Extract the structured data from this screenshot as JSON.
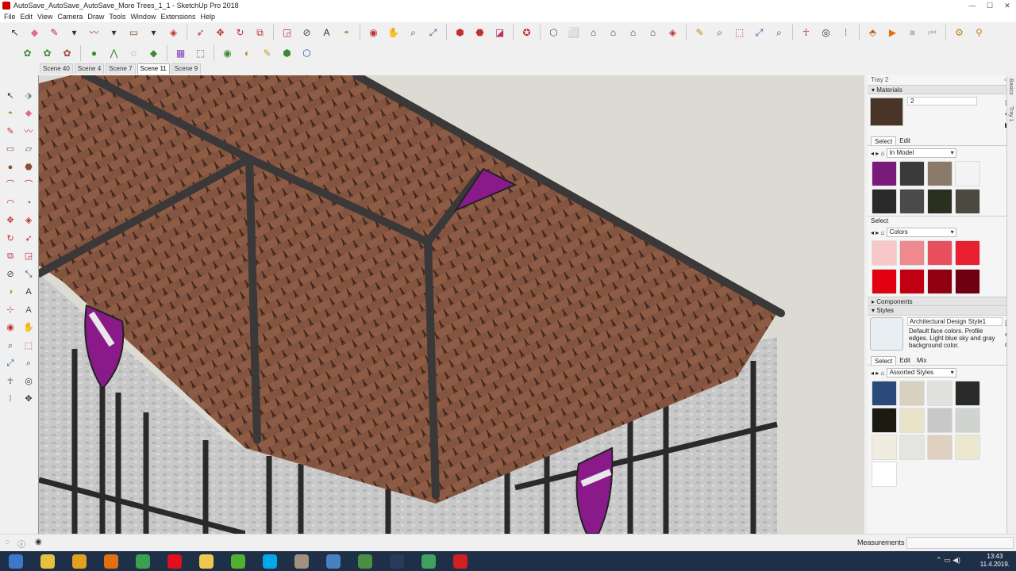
{
  "window": {
    "title": "AutoSave_AutoSave_AutoSave_More Trees_1_1 - SketchUp Pro 2018",
    "controls": {
      "minimize": "—",
      "maximize": "☐",
      "close": "✕"
    }
  },
  "menu": [
    "File",
    "Edit",
    "View",
    "Camera",
    "Draw",
    "Tools",
    "Window",
    "Extensions",
    "Help"
  ],
  "toolbar_main": [
    {
      "name": "select-icon",
      "glyph": "↖",
      "color": "#333"
    },
    {
      "name": "eraser-icon",
      "glyph": "◆",
      "color": "#e06a8a"
    },
    {
      "name": "line-pencil-icon",
      "glyph": "✎",
      "color": "#c03030"
    },
    {
      "name": "line-dropdown-icon",
      "glyph": "▾",
      "color": "#333"
    },
    {
      "name": "freehand-icon",
      "glyph": "〰",
      "color": "#c03030"
    },
    {
      "name": "freehand-dropdown-icon",
      "glyph": "▾",
      "color": "#333"
    },
    {
      "name": "rectangle-icon",
      "glyph": "▭",
      "color": "#8a5030"
    },
    {
      "name": "rectangle-dropdown-icon",
      "glyph": "▾",
      "color": "#333"
    },
    {
      "name": "push-pull-icon",
      "glyph": "◈",
      "color": "#c03030"
    },
    {
      "name": "follow-me-icon",
      "glyph": "➶",
      "color": "#c03030"
    },
    {
      "name": "move-icon",
      "glyph": "✥",
      "color": "#c03030"
    },
    {
      "name": "rotate-icon",
      "glyph": "↻",
      "color": "#c03030"
    },
    {
      "name": "scale-icon",
      "glyph": "⧉",
      "color": "#c03030"
    },
    {
      "name": "offset-icon",
      "glyph": "◲",
      "color": "#c03030"
    },
    {
      "name": "tape-measure-icon",
      "glyph": "⊘",
      "color": "#444"
    },
    {
      "name": "text-icon",
      "glyph": "A",
      "color": "#333"
    },
    {
      "name": "paint-bucket-icon",
      "glyph": "◓",
      "color": "#c08020"
    },
    {
      "name": "orbit-icon",
      "glyph": "◉",
      "color": "#c03030"
    },
    {
      "name": "pan-icon",
      "glyph": "✋",
      "color": "#c08020"
    },
    {
      "name": "zoom-icon",
      "glyph": "⌕",
      "color": "#2050a0"
    },
    {
      "name": "zoom-extents-icon",
      "glyph": "⤢",
      "color": "#2050a0"
    },
    {
      "name": "warehouse-icon",
      "glyph": "⬢",
      "color": "#c03030"
    },
    {
      "name": "extension-warehouse-icon",
      "glyph": "⬣",
      "color": "#c03030"
    },
    {
      "name": "send-to-layout-icon",
      "glyph": "◪",
      "color": "#c03060"
    },
    {
      "name": "extension-manager-icon",
      "glyph": "✪",
      "color": "#c03030"
    },
    {
      "name": "iso-view-icon",
      "glyph": "⬡",
      "color": "#555"
    },
    {
      "name": "top-view-icon",
      "glyph": "⬜",
      "color": "#555"
    },
    {
      "name": "front-view-icon",
      "glyph": "⌂",
      "color": "#333"
    },
    {
      "name": "right-view-icon",
      "glyph": "⌂",
      "color": "#333"
    },
    {
      "name": "back-view-icon",
      "glyph": "⌂",
      "color": "#333"
    },
    {
      "name": "left-view-icon",
      "glyph": "⌂",
      "color": "#333"
    },
    {
      "name": "walk-icon",
      "glyph": "◈",
      "color": "#c03030"
    },
    {
      "name": "position-camera-icon",
      "glyph": "✎",
      "color": "#c08020"
    },
    {
      "name": "zoom-window-icon",
      "glyph": "⌕",
      "color": "#2050a0"
    },
    {
      "name": "zoom-window2-icon",
      "glyph": "⬚",
      "color": "#c03030"
    },
    {
      "name": "zoom-extents2-icon",
      "glyph": "⤢",
      "color": "#2050a0"
    },
    {
      "name": "look-around-icon",
      "glyph": "⌕",
      "color": "#2050a0"
    },
    {
      "name": "walk-figure-icon",
      "glyph": "☥",
      "color": "#c03030"
    },
    {
      "name": "eye-icon",
      "glyph": "◎",
      "color": "#333"
    },
    {
      "name": "footprints-icon",
      "glyph": "⁞",
      "color": "#555"
    },
    {
      "name": "section-plane-icon",
      "glyph": "⬘",
      "color": "#c06020"
    },
    {
      "name": "play-icon",
      "glyph": "▶",
      "color": "#e07010"
    },
    {
      "name": "stop-icon",
      "glyph": "■",
      "color": "#bbb"
    },
    {
      "name": "previous-icon",
      "glyph": "⏮",
      "color": "#bbb"
    },
    {
      "name": "component-options-icon",
      "glyph": "⚙",
      "color": "#c08020"
    },
    {
      "name": "component-attributes-icon",
      "glyph": "⚲",
      "color": "#c08020"
    }
  ],
  "toolbar_second": [
    {
      "name": "sandbox-from-contours-icon",
      "glyph": "✿",
      "color": "#3a8a30"
    },
    {
      "name": "sandbox-from-scratch-icon",
      "glyph": "✿",
      "color": "#3a8a30"
    },
    {
      "name": "smoove-icon",
      "glyph": "✿",
      "color": "#a04040"
    },
    {
      "name": "stamp-icon",
      "glyph": "●",
      "color": "#3a8a30"
    },
    {
      "name": "drape-icon",
      "glyph": "⋀",
      "color": "#3a8a30"
    },
    {
      "name": "add-detail-icon",
      "glyph": "◌",
      "color": "#3a8a30"
    },
    {
      "name": "flip-edge-icon",
      "glyph": "◆",
      "color": "#3a8a30"
    },
    {
      "name": "color-by-icon",
      "glyph": "▦",
      "color": "#8040c0"
    },
    {
      "name": "vertex-tools-icon",
      "glyph": "⬚",
      "color": "#555"
    },
    {
      "name": "geo-location-icon",
      "glyph": "◉",
      "color": "#3a8a30"
    },
    {
      "name": "shadow-icon",
      "glyph": "◐",
      "color": "#c08020"
    },
    {
      "name": "photo-texture-icon",
      "glyph": "✎",
      "color": "#c0a020"
    },
    {
      "name": "model-info-icon",
      "glyph": "⬢",
      "color": "#3a8a30"
    },
    {
      "name": "match-photo-icon",
      "glyph": "⬡",
      "color": "#2050a0"
    }
  ],
  "scenes": [
    "Scene 40",
    "Scene 4",
    "Scene 7",
    "Scene 11",
    "Scene 9"
  ],
  "active_scene": "Scene 11",
  "left_tools": [
    {
      "name": "select-icon",
      "glyph": "↖",
      "color": "#333"
    },
    {
      "name": "make-component-icon",
      "glyph": "⬗",
      "color": "#888"
    },
    {
      "name": "paint-icon",
      "glyph": "◓",
      "color": "#c08020"
    },
    {
      "name": "eraser-icon",
      "glyph": "◆",
      "color": "#e06a8a"
    },
    {
      "name": "line-icon",
      "glyph": "✎",
      "color": "#c03030"
    },
    {
      "name": "freehand-icon",
      "glyph": "〰",
      "color": "#c03030"
    },
    {
      "name": "rectangle-icon",
      "glyph": "▭",
      "color": "#8a5030"
    },
    {
      "name": "rotated-rectangle-icon",
      "glyph": "▱",
      "color": "#8a5030"
    },
    {
      "name": "circle-icon",
      "glyph": "●",
      "color": "#8a5030"
    },
    {
      "name": "polygon-icon",
      "glyph": "⬣",
      "color": "#8a5030"
    },
    {
      "name": "arc-icon",
      "glyph": "⌒",
      "color": "#c03030"
    },
    {
      "name": "two-point-arc-icon",
      "glyph": "⌒",
      "color": "#c03030"
    },
    {
      "name": "three-point-arc-icon",
      "glyph": "◠",
      "color": "#c03030"
    },
    {
      "name": "pie-icon",
      "glyph": "◔",
      "color": "#8a5030"
    },
    {
      "name": "move-icon",
      "glyph": "✥",
      "color": "#c03030"
    },
    {
      "name": "push-pull-icon",
      "glyph": "◈",
      "color": "#c03030"
    },
    {
      "name": "rotate-icon",
      "glyph": "↻",
      "color": "#c03030"
    },
    {
      "name": "follow-me-icon",
      "glyph": "➶",
      "color": "#c03030"
    },
    {
      "name": "scale-icon",
      "glyph": "⧉",
      "color": "#c03030"
    },
    {
      "name": "offset-icon",
      "glyph": "◲",
      "color": "#c03030"
    },
    {
      "name": "tape-measure-icon",
      "glyph": "⊘",
      "color": "#444"
    },
    {
      "name": "dimension-icon",
      "glyph": "⤡",
      "color": "#444"
    },
    {
      "name": "protractor-icon",
      "glyph": "◑",
      "color": "#c0a020"
    },
    {
      "name": "text-icon",
      "glyph": "A",
      "color": "#333"
    },
    {
      "name": "axes-icon",
      "glyph": "⊹",
      "color": "#c03030"
    },
    {
      "name": "3d-text-icon",
      "glyph": "A",
      "color": "#555"
    },
    {
      "name": "orbit-icon",
      "glyph": "◉",
      "color": "#c03030"
    },
    {
      "name": "pan-icon",
      "glyph": "✋",
      "color": "#c08020"
    },
    {
      "name": "zoom-icon",
      "glyph": "⌕",
      "color": "#2050a0"
    },
    {
      "name": "zoom-window-icon",
      "glyph": "⬚",
      "color": "#c03030"
    },
    {
      "name": "zoom-extents-icon",
      "glyph": "⤢",
      "color": "#2050a0"
    },
    {
      "name": "previous-view-icon",
      "glyph": "⌕",
      "color": "#2050a0"
    },
    {
      "name": "position-camera-icon",
      "glyph": "☥",
      "color": "#555"
    },
    {
      "name": "look-around-icon",
      "glyph": "◎",
      "color": "#333"
    },
    {
      "name": "walk-icon",
      "glyph": "⁞",
      "color": "#555"
    },
    {
      "name": "section-plane-icon",
      "glyph": "✥",
      "color": "#333"
    }
  ],
  "tray": {
    "title": "Tray 2",
    "materials": {
      "header": "Materials",
      "current_name": "2",
      "tab_select": "Select",
      "tab_edit": "Edit",
      "library1": "In Model",
      "library1_swatches": [
        "#7a1a7a",
        "#3a3a3a",
        "#8a7a6a",
        "#f4f4f4",
        "#2a2a2a",
        "#4a4a48",
        "#2a3020",
        "#4a4a40"
      ],
      "select_label": "Select",
      "library2": "Colors",
      "library2_swatches": [
        "#f8c8c8",
        "#f08890",
        "#e85060",
        "#e82030",
        "#e00010",
        "#c00010",
        "#900010",
        "#700010"
      ]
    },
    "components": {
      "header": "Components"
    },
    "styles": {
      "header": "Styles",
      "style_name": "Architectural Design Style1",
      "style_desc": "Default face colors. Profile edges. Light blue sky and gray background color.",
      "tab_select": "Select",
      "tab_edit": "Edit",
      "tab_mix": "Mix",
      "library": "Assorted Styles",
      "swatches": [
        "#2a4a7a",
        "#d8d0c0",
        "#e0e0dc",
        "#2a2a2a",
        "#1a1a10",
        "#e8e4c8",
        "#c8c8c8",
        "#d0d4d0",
        "#f0ece0",
        "#e4e4e0",
        "#e0d0c0",
        "#ece8d0",
        "#ffffff"
      ]
    },
    "side_tabs": [
      "Basics",
      "Tray 1"
    ]
  },
  "status": {
    "measurements_label": "Measurements"
  },
  "taskbar": {
    "apps": [
      {
        "name": "start-button",
        "color": "#3a7ac8"
      },
      {
        "name": "explorer-icon",
        "color": "#e8c040"
      },
      {
        "name": "sketchup-plugin-icon",
        "color": "#e0a020"
      },
      {
        "name": "media-player-icon",
        "color": "#e07010"
      },
      {
        "name": "chrome-icon",
        "color": "#3aa050"
      },
      {
        "name": "opera-icon",
        "color": "#e01020"
      },
      {
        "name": "folder-icon",
        "color": "#f0c850"
      },
      {
        "name": "utorrent-icon",
        "color": "#50b030"
      },
      {
        "name": "skype-icon",
        "color": "#00a8e8"
      },
      {
        "name": "gimp-icon",
        "color": "#a09080"
      },
      {
        "name": "pictures-icon",
        "color": "#4a80c0"
      },
      {
        "name": "camtasia-icon",
        "color": "#4a9040"
      },
      {
        "name": "steam-icon",
        "color": "#2a3a5a"
      },
      {
        "name": "notepad-plus-icon",
        "color": "#40a060"
      },
      {
        "name": "sketchup-icon",
        "color": "#d02020"
      }
    ],
    "time": "13:43",
    "date": "11.4.2019."
  }
}
